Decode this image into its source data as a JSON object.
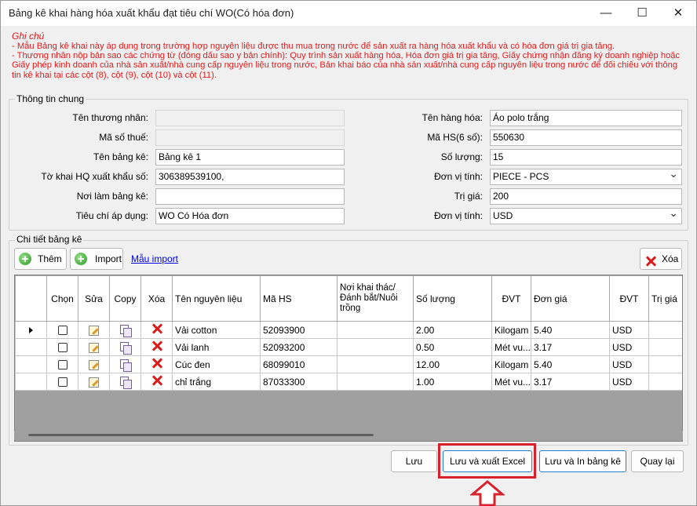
{
  "window": {
    "title": "Bảng kê khai hàng hóa xuất khẩu đạt tiêu chí WO(Có hóa đơn)",
    "minimize": "—",
    "maximize": "☐",
    "close": "✕"
  },
  "note": {
    "heading": "Ghi chú",
    "line1": "- Mẫu Bảng kê khai này áp dụng trong trường hợp nguyên liệu được thu mua trong nước để sản xuất ra hàng hóa xuất khẩu và có hóa đơn giá trị gia tăng.",
    "line2": "- Thương nhân nộp bản sao các chứng từ (đóng dấu sao y bản chính): Quy trình sản xuất hàng hóa, Hóa đơn giá trị gia tăng, Giấy chứng nhận đăng ký doanh nghiệp hoặc Giấy phép kinh doanh của nhà sản xuất/nhà cung cấp nguyên liệu trong nước, Bản khai báo của nhà sản xuất/nhà cung cấp nguyên liệu trong nước để đối chiếu với thông tin kê khai tại các cột (8), cột (9), cột (10) và cột (11)."
  },
  "general": {
    "legend": "Thông tin chung",
    "ten_thuong_nhan_label": "Tên thương nhân:",
    "ten_thuong_nhan": "",
    "ma_so_thue_label": "Mã số thuế:",
    "ma_so_thue": "",
    "ten_bang_ke_label": "Tên bảng kê:",
    "ten_bang_ke": "Bảng kê 1",
    "to_khai_label": "Tờ khai HQ xuất khẩu số:",
    "to_khai": "306389539100,",
    "noi_lam_label": "Nơi làm bảng kê:",
    "noi_lam": "",
    "tieu_chi_label": "Tiêu chí áp dụng:",
    "tieu_chi": "WO Có Hóa đơn",
    "ten_hang_label": "Tên hàng hóa:",
    "ten_hang": "Áo polo trắng",
    "ma_hs_label": "Mã HS(6 số):",
    "ma_hs": "550630",
    "so_luong_label": "Số lượng:",
    "so_luong": "15",
    "don_vi_label": "Đơn vị tính:",
    "don_vi": "PIECE - PCS",
    "tri_gia_label": "Trị giá:",
    "tri_gia": "200",
    "don_vi2_label": "Đơn vị tính:",
    "don_vi2": "USD"
  },
  "detail": {
    "legend": "Chi tiết bảng kê",
    "add_label": "Thêm",
    "import_label": "Import",
    "template_link": "Mẫu import",
    "delete_label": "Xóa",
    "columns": [
      "Chọn",
      "Sửa",
      "Copy",
      "Xóa",
      "Tên nguyên liệu",
      "Mã HS",
      "Nơi khai thác/Đánh bắt/Nuôi trồng",
      "Số lượng",
      "ĐVT",
      "Đơn giá",
      "ĐVT",
      "Trị giá"
    ],
    "rows": [
      {
        "name": "Vải cotton",
        "hs": "52093900",
        "origin": "",
        "qty": "2.00",
        "unit": "Kilogam",
        "price": "5.40",
        "currency": "USD"
      },
      {
        "name": "Vải lanh",
        "hs": "52093200",
        "origin": "",
        "qty": "0.50",
        "unit": "Mét vu...",
        "price": "3.17",
        "currency": "USD"
      },
      {
        "name": "Cúc đen",
        "hs": "68099010",
        "origin": "",
        "qty": "12.00",
        "unit": "Kilogam",
        "price": "5.40",
        "currency": "USD"
      },
      {
        "name": "chỉ trắng",
        "hs": "87033300",
        "origin": "",
        "qty": "1.00",
        "unit": "Mét vu...",
        "price": "3.17",
        "currency": "USD"
      }
    ]
  },
  "footer": {
    "save": "Lưu",
    "save_excel": "Lưu và xuất Excel",
    "save_print": "Lưu và In bảng kê",
    "back": "Quay lại"
  },
  "colors": {
    "note_red": "#e31b1b",
    "highlight_red": "#d8212a"
  }
}
